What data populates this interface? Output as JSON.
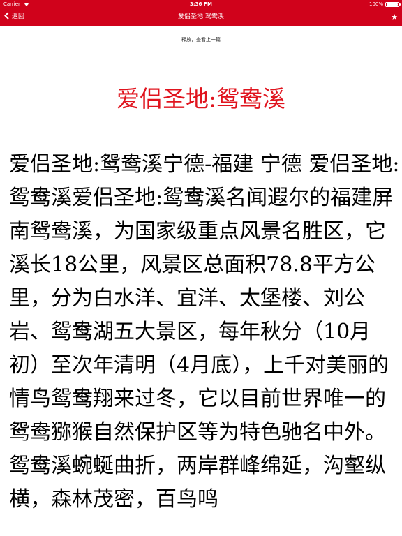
{
  "status_bar": {
    "carrier": "Carrier",
    "wifi_icon": "wifi-icon",
    "time": "3:36 PM",
    "battery_percent": "100%",
    "battery_level": 1.0,
    "background_color": "#d0021b"
  },
  "nav_bar": {
    "back_label": "返回",
    "back_icon": "chevron-left-icon",
    "title": "爱侣圣地:鸳鸯溪",
    "favorite_icon": "star-icon",
    "favorite_glyph": "★",
    "background_color": "#d0021b"
  },
  "pull_hint": "释放，查看上一篇",
  "article": {
    "title": "爱侣圣地:鸳鸯溪",
    "title_color": "#e0141e",
    "body": "爱侣圣地:鸳鸯溪宁德-福建 宁德 爱侣圣地:鸳鸯溪爱侣圣地:鸳鸯溪名闻遐尔的福建屏南鸳鸯溪，为国家级重点风景名胜区，它溪长18公里，风景区总面积78.8平方公里，分为白水洋、宜洋、太堡楼、刘公岩、鸳鸯湖五大景区，每年秋分（10月初）至次年清明（4月底），上千对美丽的情鸟鸳鸯翔来过冬，它以目前世界唯一的鸳鸯猕猴自然保护区等为特色驰名中外。鸳鸯溪蜿蜒曲折，两岸群峰绵延，沟壑纵横，森林茂密，百鸟鸣"
  }
}
